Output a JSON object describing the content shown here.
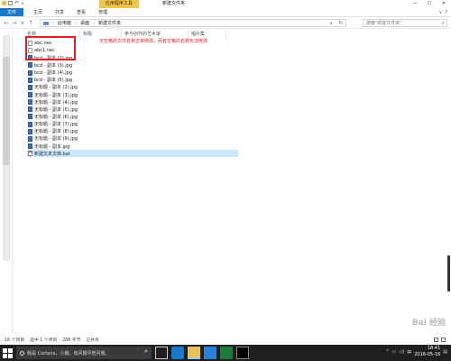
{
  "titlebar": {
    "contextual_tab": "应用程序工具",
    "title": "新建文件夹",
    "minimize": "—",
    "maximize": "☐",
    "close": "✕"
  },
  "ribbon": {
    "tabs": [
      "文件",
      "主页",
      "共享",
      "查看",
      "管理"
    ],
    "expand": "∨",
    "help": "?"
  },
  "address": {
    "back": "←",
    "forward": "→",
    "recent": "∨",
    "up": "↑",
    "crumbs": [
      "此电脑",
      "桌面",
      "新建文件夹"
    ],
    "separator": "›",
    "dropdown": "∨",
    "refresh": "↻"
  },
  "search": {
    "placeholder": "搜索\"新建文件夹\""
  },
  "columns": {
    "name": "名称",
    "tags": "标题",
    "contrib": "参与创作的艺术家",
    "album": "唱片集"
  },
  "files": [
    {
      "name": "abc.nec",
      "type": "doc"
    },
    {
      "name": "abc1.nec",
      "type": "doc"
    },
    {
      "name": "bcd - 副本 (2).jpg",
      "type": "img"
    },
    {
      "name": "bcd - 副本 (3).jpg",
      "type": "img"
    },
    {
      "name": "bcd - 副本 (4).jpg",
      "type": "img"
    },
    {
      "name": "bcd - 副本 (5).jpg",
      "type": "img"
    },
    {
      "name": "无标题 - 副本 (2).jpg",
      "type": "img"
    },
    {
      "name": "无标题 - 副本 (3).jpg",
      "type": "img"
    },
    {
      "name": "无标题 - 副本 (4).jpg",
      "type": "img"
    },
    {
      "name": "无标题 - 副本 (5).jpg",
      "type": "img"
    },
    {
      "name": "无标题 - 副本 (6).jpg",
      "type": "img"
    },
    {
      "name": "无标题 - 副本 (7).jpg",
      "type": "img"
    },
    {
      "name": "无标题 - 副本 (8).jpg",
      "type": "img"
    },
    {
      "name": "无标题 - 副本 (9).jpg",
      "type": "img"
    },
    {
      "name": "无标题 - 副本.jpg",
      "type": "img"
    },
    {
      "name": "新建文本文档.bat",
      "type": "bat",
      "selected": true
    }
  ],
  "annotation": "无空格的文件名称正常修改，而有空格的名称无法修改",
  "status": {
    "count": "16 个项目",
    "selected": "选中 1 个项目",
    "size": "286 字节",
    "shared": "已共享"
  },
  "taskbar": {
    "cortana": "我是 Cortana，小娜。有问题尽管问我。",
    "mic": "🎤",
    "ime": "中",
    "time": "18:41",
    "date": "2016-05-16"
  },
  "watermark": "Bai 经验",
  "colors": {
    "accent": "#1979ca",
    "contextual": "#f0c64c",
    "annotation": "#e02020",
    "selection": "#cce8ff"
  }
}
